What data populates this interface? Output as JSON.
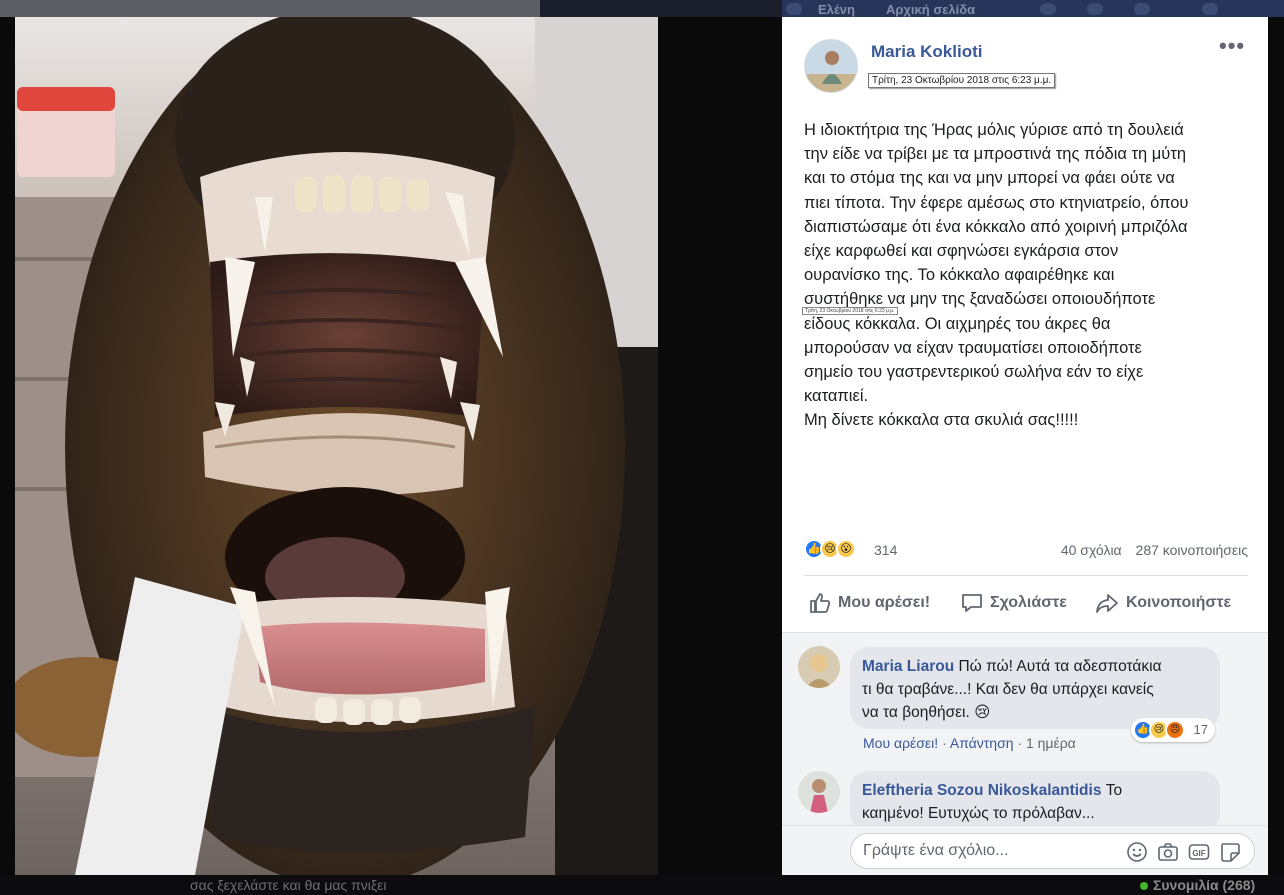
{
  "topbar": {
    "items": [
      "Ελένη",
      "Αρχική σελίδα"
    ]
  },
  "photo": {
    "description_icon": "photo-dog-open-mouth-bone"
  },
  "post": {
    "author": "Maria Koklioti",
    "timestamp": "Τρίτη, 23 Οκτωβρίου 2018 στις 6:23 μ.μ.",
    "timestamp_small": "Τρίτη, 23 Οκτωβρίου 2018 στις 6:23 μ.μ.",
    "more_label": "•••",
    "text_lines": [
      "Η ιδιοκτήτρια της Ήρας μόλις γύρισε από τη δουλειά",
      "την είδε να τρίβει με τα μπροστινά της πόδια τη μύτη",
      "και το στόμα της και να μην μπορεί να φάει ούτε να",
      "πιει τίποτα. Την έφερε αμέσως στο κτηνιατρείο, όπου",
      "διαπιστώσαμε ότι ένα κόκκαλο από χοιρινή μπριζόλα",
      "είχε καρφωθεί και σφηνώσει εγκάρσια στον",
      "ουρανίσκο της. Το κόκκαλο αφαιρέθηκε και",
      "συστήθηκε να μην της ξαναδώσει οποιουδήποτε",
      "είδους κόκκαλα. Οι αιχμηρές του άκρες θα",
      "μπορούσαν να είχαν τραυματίσει οποιοδήποτε",
      "σημείο του γαστρεντερικού σωλήνα εάν το είχε",
      "καταπιεί.",
      "Μη δίνετε κόκκαλα στα σκυλιά σας!!!!!"
    ],
    "reaction_count": "314",
    "comments_count": "40 σχόλια",
    "shares_count": "287 κοινοποιήσεις",
    "actions": {
      "like": "Μου αρέσει!",
      "comment": "Σχολιάστε",
      "share": "Κοινοποιήστε"
    }
  },
  "comments": [
    {
      "name": "Maria Liarou",
      "text_line1": "Πώ πώ! Αυτά τα αδεσποτάκια",
      "text_line2": "τι θα τραβάνε...! Και δεν θα υπάρχει κανείς",
      "text_line3": "να τα βοηθήσει. 😢",
      "like_label": "Μου αρέσει!",
      "reply_label": "Απάντηση",
      "when": "1 ημέρα",
      "reaction_count": "17"
    },
    {
      "name": "Eleftheria Sozou Nikoskalantidis",
      "text_line1": "Το",
      "text_line2": "καημένο! Ευτυχώς το πρόλαβαν..."
    }
  ],
  "composer": {
    "placeholder": "Γράψτε ένα σχόλιο..."
  },
  "bottombar": {
    "ghost_text": "σας ξεχελάστε και θα μας πνιξει",
    "chat_label": "Συνομιλία (268)"
  },
  "colors": {
    "link": "#385898",
    "like_blue": "#2078f4",
    "reaction_yellow": "#f7c84b",
    "angry": "#e9710f"
  }
}
